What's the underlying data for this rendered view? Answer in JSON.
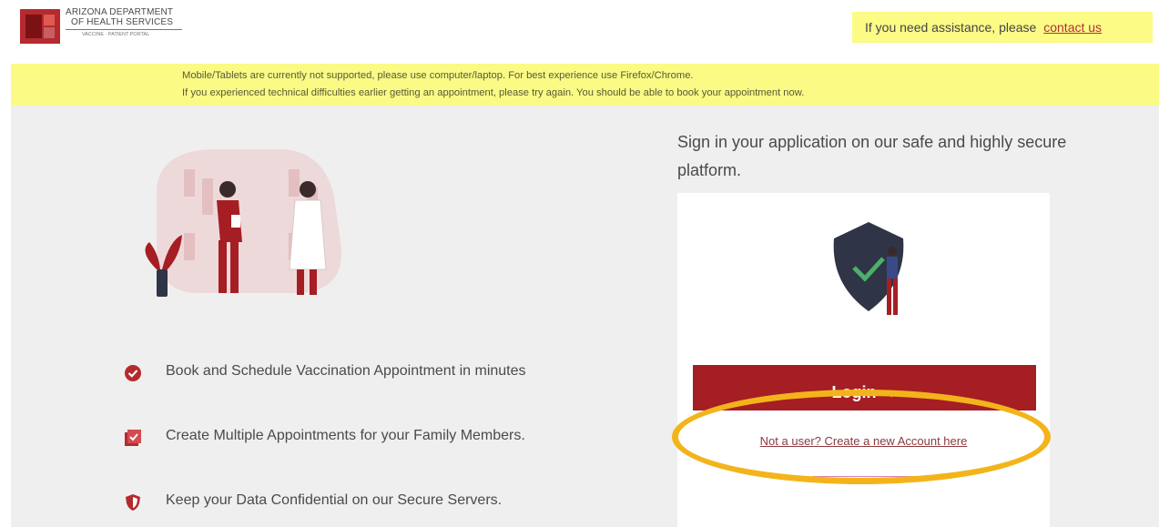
{
  "header": {
    "logo": {
      "line1": "ARIZONA DEPARTMENT",
      "line2": "OF HEALTH SERVICES",
      "line3": "VACCINE · PATIENT PORTAL",
      "brand_color": "#b52a2e"
    },
    "assist_text": "If you need assistance, please",
    "assist_link": "contact us"
  },
  "banner": {
    "line1": "Mobile/Tablets are currently not supported, please use computer/laptop. For best experience use Firefox/Chrome.",
    "line2": "If you experienced technical difficulties earlier getting an appointment, please try again. You should be able to book your appointment now.",
    "bg_color": "#fafa85"
  },
  "features": [
    {
      "icon": "check-circle-icon",
      "text": "Book and Schedule Vaccination Appointment in minutes"
    },
    {
      "icon": "calendar-check-icon",
      "text": "Create Multiple Appointments for your Family Members."
    },
    {
      "icon": "shield-icon",
      "text": "Keep your Data Confidential on our Secure Servers."
    }
  ],
  "signin": {
    "heading": "Sign in your application on our safe and highly secure platform.",
    "login_label": "Login →",
    "create_account_link": "Not a user? Create a new Account here"
  },
  "colors": {
    "accent": "#a51e24",
    "highlight": "#f3b41b",
    "panel": "#efefef"
  }
}
